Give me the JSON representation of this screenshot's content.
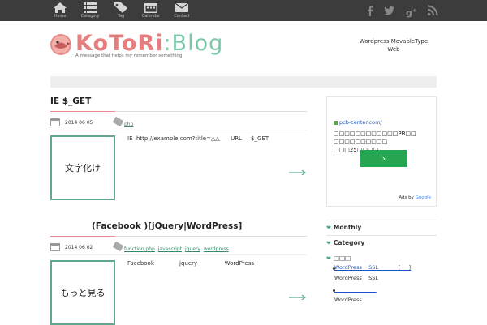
{
  "nav": {
    "items": [
      {
        "label": "Home",
        "icon": "home-icon"
      },
      {
        "label": "Category",
        "icon": "list-icon"
      },
      {
        "label": "Tag",
        "icon": "tag-icon"
      },
      {
        "label": "Calendar",
        "icon": "calendar-icon"
      },
      {
        "label": "Contact",
        "icon": "mail-icon"
      }
    ],
    "social": [
      "facebook-icon",
      "twitter-icon",
      "google-plus-icon",
      "rss-icon"
    ]
  },
  "header": {
    "logo_kotori": "KoToRi",
    "logo_sep": ":",
    "logo_blog": "Blog",
    "tagline": "A message that helps my remember something",
    "links": [
      "Wordpress MovableType",
      "Web"
    ]
  },
  "posts": [
    {
      "title": "IE $_GET",
      "date": "2014 06 05",
      "tags": [
        "php"
      ],
      "thumb_text": "文字化け",
      "excerpt": "IE  http://example.com?title=△△      URL     $_GET"
    },
    {
      "title": "(Facebook  )[jQuery|WordPress]",
      "date": "2014 06 02",
      "tags": [
        "function.php",
        "javascript",
        "jquery",
        "wordpress"
      ],
      "thumb_text": "もっと見る",
      "excerpt": "Facebook              jquery               WordPress"
    }
  ],
  "sidebar": {
    "ad": {
      "url": "pcb-center.com/",
      "text": "□□□□□□□□□□□□PB□□ □□□□□□□□□□ □□□25□□□□",
      "button": "›",
      "ads_by": "Ads by",
      "google": "Google"
    },
    "monthly": "Monthly",
    "category": "Category",
    "recent_label": "□□□",
    "recent_items": [
      {
        "link": "WordPress    SSL            [     ]",
        "sub": "WordPress    SSL"
      },
      {
        "link": "                         ",
        "sub": "WordPress"
      }
    ]
  },
  "colors": {
    "accent_green": "#5fa88c",
    "accent_pink": "#e98b8b",
    "topbar": "#3c3c3c"
  }
}
